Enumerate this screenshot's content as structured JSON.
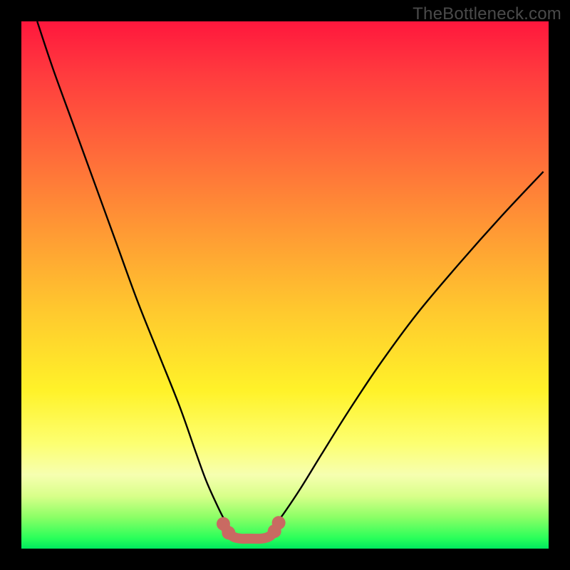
{
  "watermark": "TheBottleneck.com",
  "chart_data": {
    "type": "line",
    "title": "",
    "xlabel": "",
    "ylabel": "",
    "xlim": [
      0,
      100
    ],
    "ylim": [
      0,
      100
    ],
    "grid": false,
    "legend": false,
    "series": [
      {
        "name": "left-curve",
        "color": "#000000",
        "x": [
          3,
          6,
          10,
          14,
          18,
          22,
          26,
          30,
          33,
          35,
          37,
          38.5,
          40
        ],
        "values": [
          100,
          91,
          80,
          69,
          58,
          47,
          37,
          27,
          18.5,
          13,
          8.5,
          5.5,
          3.3
        ]
      },
      {
        "name": "right-curve",
        "color": "#000000",
        "x": [
          47,
          48.5,
          50,
          53,
          57,
          62,
          68,
          75,
          83,
          91,
          99
        ],
        "values": [
          3.3,
          5,
          7,
          11.5,
          18,
          26,
          35,
          44.5,
          54,
          63,
          71.5
        ]
      },
      {
        "name": "bottom-round",
        "color": "#c96a62",
        "x": [
          38.3,
          39.3,
          40.3,
          41.6,
          43.5,
          45.5,
          47.0,
          48.0,
          48.8
        ],
        "values": [
          4.7,
          3.0,
          2.2,
          1.9,
          1.9,
          1.9,
          2.3,
          3.3,
          4.9
        ]
      },
      {
        "name": "dots",
        "color": "#c96a62",
        "x": [
          38.3,
          39.3,
          40.3,
          41.6,
          43.5,
          45.5,
          47.0,
          48.0,
          48.8
        ],
        "values": [
          4.7,
          3.0,
          2.2,
          1.9,
          1.9,
          1.9,
          2.3,
          3.3,
          4.9
        ]
      }
    ],
    "annotations": []
  }
}
